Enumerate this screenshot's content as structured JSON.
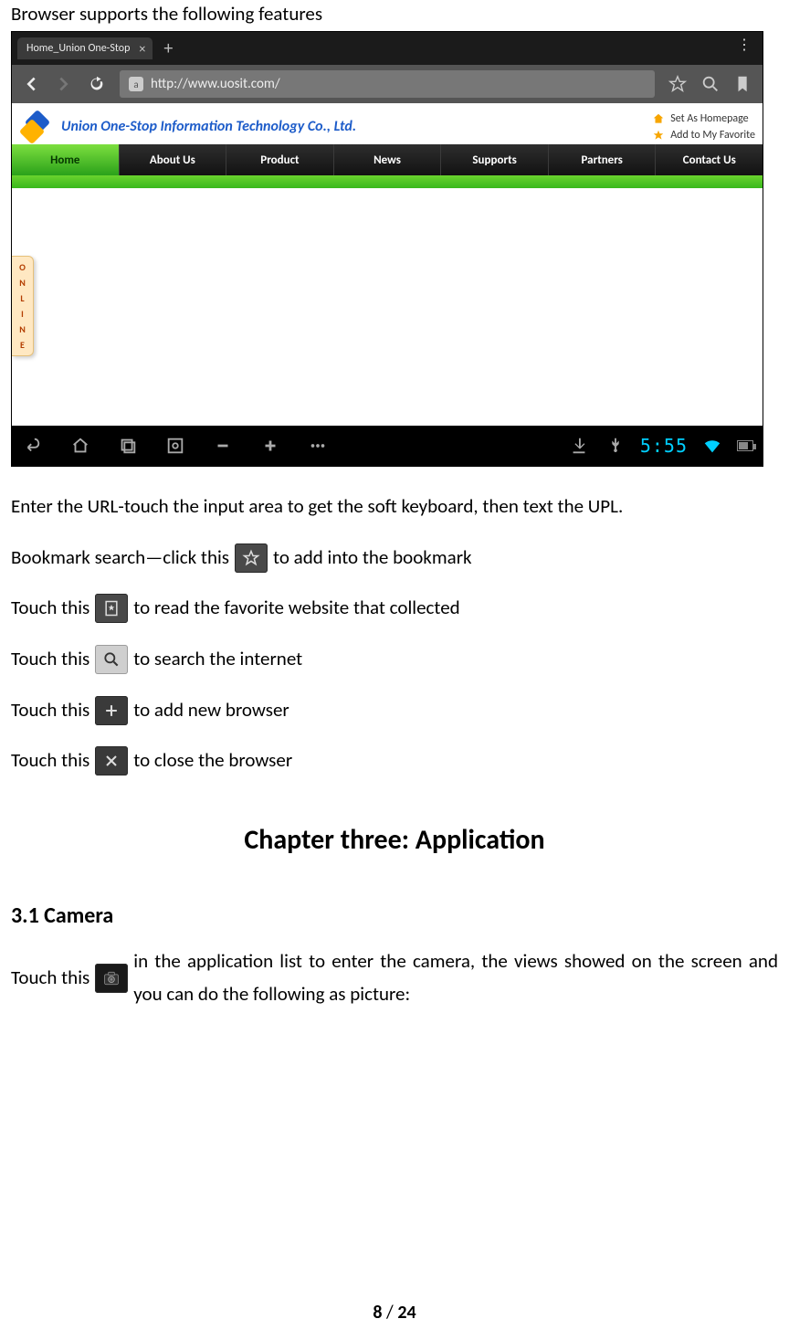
{
  "intro_line": "Browser supports the following features",
  "screenshot": {
    "tab": {
      "title": "Home_Union One-Stop"
    },
    "url": "http://www.uosit.com/",
    "brand_name": "Union One-Stop Information Technology Co., Ltd.",
    "head_links": {
      "homepage": "Set As Homepage",
      "favorite": "Add to My Favorite"
    },
    "nav": [
      "Home",
      "About Us",
      "Product",
      "News",
      "Supports",
      "Partners",
      "Contact Us"
    ],
    "nav_active_index": 0,
    "side_tongue": [
      "O",
      "N",
      "L",
      "I",
      "N",
      "E"
    ],
    "clock": "5:55"
  },
  "body": {
    "enter_url": "Enter the URL-touch the input area to get the soft keyboard, then text the UPL.",
    "bookmark_pre": "Bookmark search—click this",
    "bookmark_post": "to add into the bookmark",
    "fav_pre": "Touch this",
    "fav_post": "to read the favorite website that collected",
    "search_pre": "Touch this",
    "search_post": "to search the internet",
    "add_pre": "Touch this",
    "add_post": "to add new browser",
    "close_pre": "Touch this",
    "close_post": "to close the browser"
  },
  "chapter_title": "Chapter three: Application",
  "section_31_title": "3.1 Camera",
  "section_31": {
    "pre": "Touch this",
    "post": "in the application list to enter the camera, the views showed on the screen and you can do the following as picture:"
  },
  "page_footer": {
    "current": "8",
    "sep": " / ",
    "total": "24"
  }
}
